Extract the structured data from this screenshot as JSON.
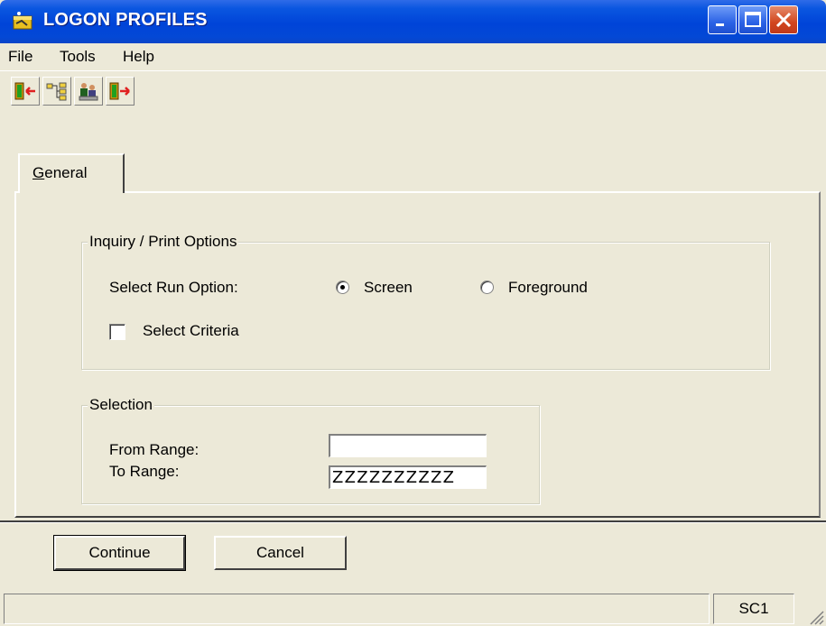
{
  "window": {
    "title": "LOGON PROFILES"
  },
  "menu": {
    "items": [
      {
        "label": "File"
      },
      {
        "label": "Tools"
      },
      {
        "label": "Help"
      }
    ]
  },
  "toolbar": {
    "buttons": [
      {
        "icon": "exit-door-icon"
      },
      {
        "icon": "tree-view-icon"
      },
      {
        "icon": "users-icon"
      },
      {
        "icon": "door-exit-icon"
      }
    ]
  },
  "tabs": [
    {
      "label": "General",
      "active": true
    }
  ],
  "inquiry": {
    "title": "Inquiry / Print Options",
    "run_option_label": "Select Run Option:",
    "options": [
      {
        "label": "Screen",
        "selected": true
      },
      {
        "label": "Foreground",
        "selected": false
      }
    ],
    "criteria_label": "Select Criteria",
    "criteria_checked": false
  },
  "selection": {
    "title": "Selection",
    "from_label": "From Range:",
    "from_value": "",
    "to_label": "To Range:",
    "to_value": "ZZZZZZZZZZ"
  },
  "buttons": {
    "continue": "Continue",
    "cancel": "Cancel"
  },
  "status": {
    "main": "",
    "code": "SC1"
  },
  "colors": {
    "face": "#ECE9D8",
    "titlebar": "#0044D8",
    "close": "#D2461E"
  }
}
